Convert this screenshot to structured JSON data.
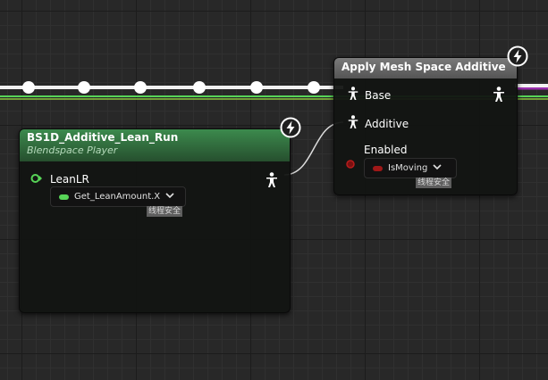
{
  "colors": {
    "pose_wire": "#f2f2f2",
    "bool_wire": "#9a1a1a",
    "float_wire": "#57d457",
    "node_a_header": "#2e6b3c",
    "node_b_header": "#6a6a6a"
  },
  "blendspace_node": {
    "title": "BS1D_Additive_Lean_Run",
    "subtitle": "Blendspace Player",
    "pin_label": "LeanLR",
    "combo_value": "Get_LeanAmount.X",
    "thread_safe_badge": "线程安全",
    "output_icon": "pose-output-icon",
    "fast_path_icon": "lightning-icon"
  },
  "apply_node": {
    "title": "Apply Mesh Space Additive",
    "pin_base": "Base",
    "pin_additive": "Additive",
    "pin_enabled": "Enabled",
    "combo_value": "IsMoving",
    "thread_safe_badge": "线程安全",
    "output_icon": "pose-output-icon",
    "fast_path_icon": "lightning-icon"
  }
}
